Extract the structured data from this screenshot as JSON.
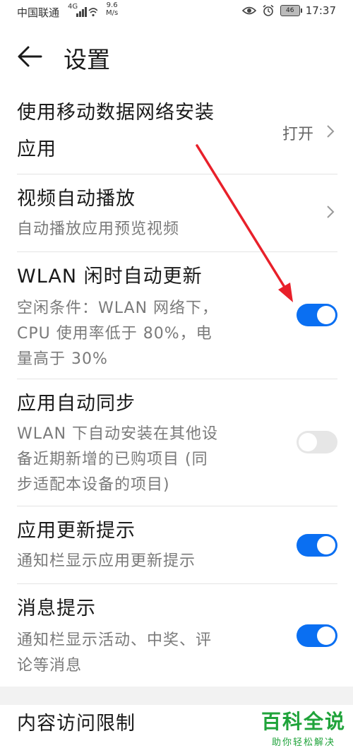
{
  "status_bar": {
    "carrier": "中国联通",
    "network": "4G",
    "speed_value": "9.6",
    "speed_unit": "M/s",
    "battery": "46",
    "time": "17:37"
  },
  "header": {
    "title": "设置"
  },
  "settings": {
    "mobile_data_install": {
      "title_line1": "使用移动数据网络安装",
      "title_line2": "应用",
      "value": "打开"
    },
    "video_autoplay": {
      "title": "视频自动播放",
      "subtitle": "自动播放应用预览视频"
    },
    "wlan_idle_update": {
      "title": "WLAN 闲时自动更新",
      "subtitle_line1": "空闲条件：WLAN 网络下，",
      "subtitle_line2": "CPU 使用率低于 80%，电",
      "subtitle_line3": "量高于 30%",
      "enabled": true
    },
    "app_auto_sync": {
      "title": "应用自动同步",
      "subtitle_line1": "WLAN 下自动安装在其他设",
      "subtitle_line2": "备近期新增的已购项目 (同",
      "subtitle_line3": "步适配本设备的项目)",
      "enabled": false
    },
    "update_notice": {
      "title": "应用更新提示",
      "subtitle": "通知栏显示应用更新提示",
      "enabled": true
    },
    "message_notice": {
      "title": "消息提示",
      "subtitle_line1": "通知栏显示活动、中奖、评",
      "subtitle_line2": "论等消息",
      "enabled": true
    },
    "content_restriction": {
      "title": "内容访问限制"
    }
  },
  "watermark": {
    "main": "百科全说",
    "sub": "助你轻松解决"
  },
  "colors": {
    "toggle_on": "#0a6ff2",
    "toggle_off": "#e6e6e6",
    "annotation_arrow": "#e8202a",
    "watermark": "#1fa33a"
  }
}
